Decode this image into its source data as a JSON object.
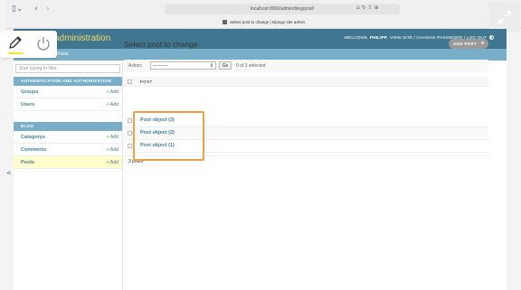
{
  "browser": {
    "url": "localhost:8000/admin/blog/post/",
    "tab_title": "Select post to change | Django site admin"
  },
  "header": {
    "brand": "administration",
    "welcome_prefix": "WELCOME, ",
    "username": "PHILIPP",
    "links": ". VIEW SITE / CHANGE PASSWORD / LOG OUT"
  },
  "breadcrumbs": "Posts",
  "sidebar": {
    "filter_placeholder": "Start typing to filter...",
    "add_label": "Add",
    "modules": [
      {
        "title": "AUTHENTICATION AND AUTHORIZATION",
        "items": [
          "Groups",
          "Users"
        ]
      },
      {
        "title": "BLOG",
        "items": [
          "Categorys",
          "Comments",
          "Posts"
        ]
      }
    ]
  },
  "content": {
    "title": "Select post to change",
    "add_button": "ADD POST",
    "action_label": "Action:",
    "action_value": "----------",
    "go_button": "Go",
    "selected_count": "0 of 3 selected",
    "column_header": "POST",
    "rows": [
      "Post object (3)",
      "Post object (2)",
      "Post object (1)"
    ],
    "paginator": "3 posts"
  },
  "colors": {
    "header_bg": "#417690",
    "brand": "#f5dd5d",
    "module_header": "#79aec8",
    "link": "#447e9b",
    "highlight": "#f0a041"
  }
}
